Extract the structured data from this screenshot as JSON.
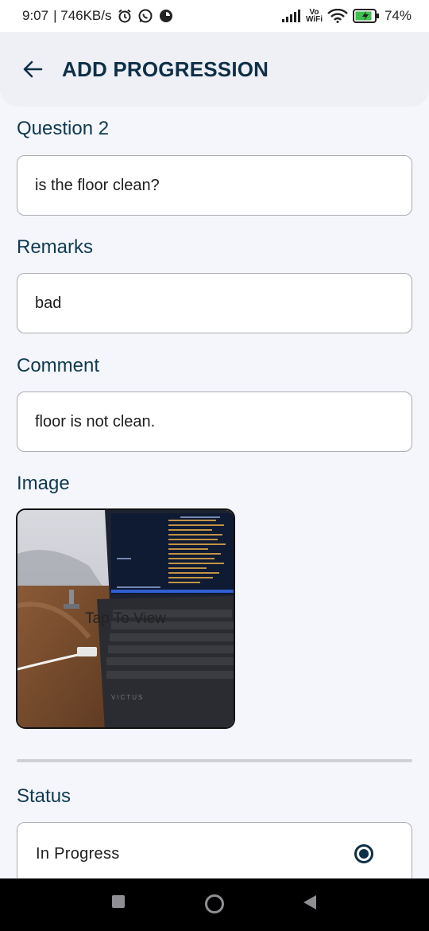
{
  "status_bar": {
    "time": "9:07",
    "net_speed": "| 746KB/s",
    "vowifi_top": "Vo",
    "vowifi_bottom": "WiFi",
    "battery": "74%",
    "icons": [
      "alarm-icon",
      "whatsapp-icon",
      "app-notification-icon",
      "signal-icon",
      "wifi-icon",
      "battery-charging-icon"
    ]
  },
  "app_bar": {
    "back_icon": "arrow-left-icon",
    "title": "ADD PROGRESSION"
  },
  "form": {
    "question_label": "Question 2",
    "question_value": "is the floor clean?",
    "remarks_label": "Remarks",
    "remarks_value": "bad",
    "comment_label": "Comment",
    "comment_value": "floor is not clean.",
    "image_label": "Image",
    "image_tap_text": "Tap To View",
    "status_label": "Status",
    "status_value": "In Progress"
  },
  "nav_bar": {
    "icons": [
      "recents-square-icon",
      "home-circle-icon",
      "back-triangle-icon"
    ]
  },
  "colors": {
    "accent": "#0e2f47",
    "label": "#0e3a52",
    "background": "#f5f6fb"
  }
}
